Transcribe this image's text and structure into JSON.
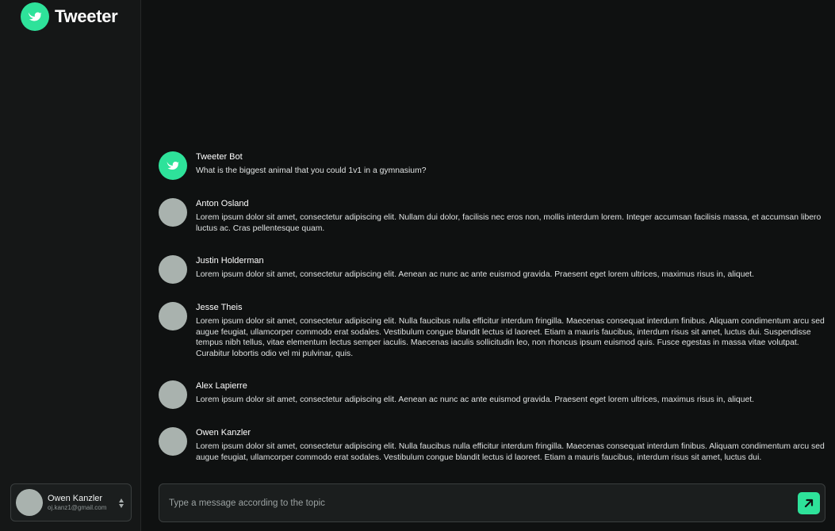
{
  "app": {
    "name": "Tweeter",
    "accent_color": "#2ee29a"
  },
  "account": {
    "name": "Owen Kanzler",
    "email": "oj.kanz1@gmail.com"
  },
  "messages": [
    {
      "author": "Tweeter Bot",
      "is_bot": true,
      "text": "What is the biggest animal that you could 1v1 in a gymnasium?"
    },
    {
      "author": "Anton Osland",
      "is_bot": false,
      "text": "Lorem ipsum dolor sit amet, consectetur adipiscing elit. Nullam dui dolor, facilisis nec eros non, mollis interdum lorem. Integer accumsan facilisis massa, et accumsan libero luctus ac. Cras pellentesque quam."
    },
    {
      "author": "Justin Holderman",
      "is_bot": false,
      "text": "Lorem ipsum dolor sit amet, consectetur adipiscing elit. Aenean ac nunc ac ante euismod gravida. Praesent eget lorem ultrices, maximus risus in, aliquet."
    },
    {
      "author": "Jesse Theis",
      "is_bot": false,
      "text": "Lorem ipsum dolor sit amet, consectetur adipiscing elit. Nulla faucibus nulla efficitur interdum fringilla. Maecenas consequat interdum finibus. Aliquam condimentum arcu sed augue feugiat, ullamcorper commodo erat sodales. Vestibulum congue blandit lectus id laoreet. Etiam a mauris faucibus, interdum risus sit amet, luctus dui. Suspendisse tempus nibh tellus, vitae elementum lectus semper iaculis. Maecenas iaculis sollicitudin leo, non rhoncus ipsum euismod quis. Fusce egestas in massa vitae volutpat. Curabitur lobortis odio vel mi pulvinar, quis."
    },
    {
      "author": "Alex Lapierre",
      "is_bot": false,
      "text": "Lorem ipsum dolor sit amet, consectetur adipiscing elit. Aenean ac nunc ac ante euismod gravida. Praesent eget lorem ultrices, maximus risus in, aliquet."
    },
    {
      "author": "Owen Kanzler",
      "is_bot": false,
      "text": "Lorem ipsum dolor sit amet, consectetur adipiscing elit. Nulla faucibus nulla efficitur interdum fringilla. Maecenas consequat interdum finibus. Aliquam condimentum arcu sed augue feugiat, ullamcorper commodo erat sodales. Vestibulum congue blandit lectus id laoreet. Etiam a mauris faucibus, interdum risus sit amet, luctus dui."
    }
  ],
  "composer": {
    "placeholder": "Type a message according to the topic",
    "value": "",
    "send_icon": "arrow-up-right-icon"
  }
}
